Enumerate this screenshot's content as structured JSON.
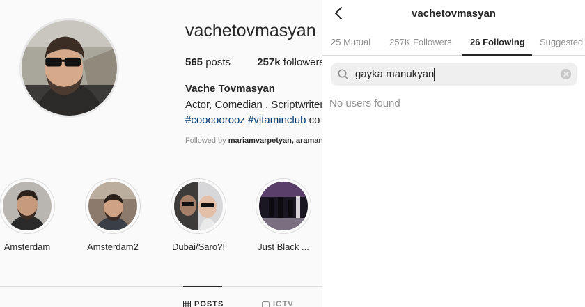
{
  "profile": {
    "username": "vachetovmasyan",
    "stats": {
      "posts_count": "565",
      "posts_label": "posts",
      "followers_count": "257k",
      "followers_label": "followers"
    },
    "full_name": "Vache Tovmasyan",
    "bio": "Actor, Comedian , Scriptwriter",
    "hashtags": {
      "tag1": "#coocoorooz",
      "tag2": "#vitaminclub",
      "tail": "co"
    },
    "followed_by": {
      "prefix": "Followed by",
      "names": "mariamvarpetyan, araman"
    }
  },
  "highlights": [
    {
      "label": "Amsterdam"
    },
    {
      "label": "Amsterdam2"
    },
    {
      "label": "Dubai/Saro?!"
    },
    {
      "label": "Just Black ..."
    }
  ],
  "profile_tabs": [
    {
      "label": "POSTS",
      "icon": "grid-icon",
      "active": true
    },
    {
      "label": "IGTV",
      "icon": "igtv-icon",
      "active": false
    }
  ],
  "following_panel": {
    "title": "vachetovmasyan",
    "tabs": [
      {
        "label": "25 Mutual"
      },
      {
        "label": "257K Followers"
      },
      {
        "label": "26 Following"
      },
      {
        "label": "Suggested"
      }
    ],
    "active_tab": "26 Following",
    "search": {
      "value": "gayka manukyan"
    },
    "empty_message": "No users found"
  },
  "colors": {
    "link": "#00376b",
    "muted": "#8e8e8e",
    "text": "#262626"
  }
}
